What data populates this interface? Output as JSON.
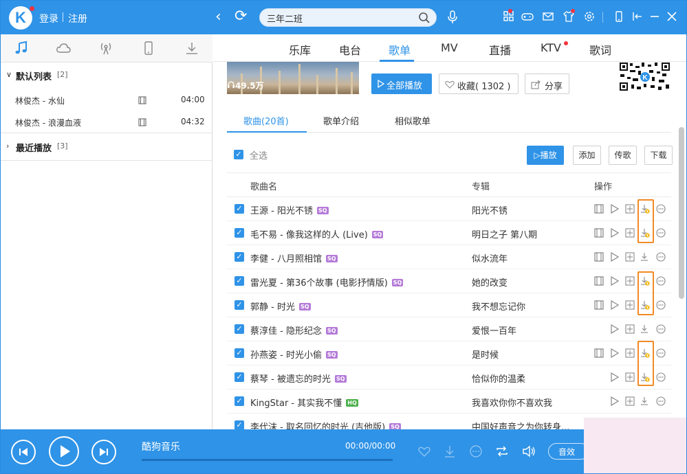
{
  "topbar": {
    "logo": "K",
    "login": "登录",
    "register": "注册",
    "search_value": "三年二班"
  },
  "left": {
    "groups": [
      {
        "name": "默认列表",
        "count": "[2]"
      },
      {
        "name": "最近播放",
        "count": "[3]"
      }
    ],
    "songs": [
      {
        "title": "林俊杰 - 水仙",
        "duration": "04:00"
      },
      {
        "title": "林俊杰 - 浪漫血液",
        "duration": "04:32"
      }
    ]
  },
  "main": {
    "tabs": [
      "乐库",
      "电台",
      "歌单",
      "MV",
      "直播",
      "KTV",
      "歌词"
    ],
    "active_tab": "歌单",
    "cover_count": "49.5万",
    "play_all": "全部播放",
    "favorite": "收藏( 1302 )",
    "share": "分享",
    "subtabs": [
      "歌曲(20首)",
      "歌单介绍",
      "相似歌单"
    ],
    "select_all": "全选",
    "actions": {
      "play": "播放",
      "add": "添加",
      "upload": "传歌",
      "download": "下载"
    },
    "columns": {
      "name": "歌曲名",
      "album": "专辑",
      "ops": "操作"
    },
    "songs": [
      {
        "name": "王源 - 阳光不锈",
        "quality": "SQ",
        "album": "阳光不锈"
      },
      {
        "name": "毛不易 - 像我这样的人 (Live)",
        "quality": "SQ",
        "album": "明日之子 第八期"
      },
      {
        "name": "李健 - 八月照相馆",
        "quality": "SQ",
        "album": "似水流年"
      },
      {
        "name": "雷光夏 - 第36个故事 (电影抒情版)",
        "quality": "SQ",
        "album": "她的改变"
      },
      {
        "name": "郭静 - 时光",
        "quality": "SQ",
        "album": "我不想忘记你"
      },
      {
        "name": "蔡淳佳 - 隐形纪念",
        "quality": "SQ",
        "album": "爱恨一百年"
      },
      {
        "name": "孙燕姿 - 时光小偷",
        "quality": "SQ",
        "album": "是时候"
      },
      {
        "name": "蔡琴 - 被遗忘的时光",
        "quality": "SQ",
        "album": "恰似你的温柔"
      },
      {
        "name": "KingStar - 其实我不懂",
        "quality": "HQ",
        "album": "我喜欢你你不喜欢我"
      },
      {
        "name": "李代沫 - 取名回忆的时光 (吉他版)",
        "quality": "SQ",
        "album": "中国好声音之为你转身..."
      }
    ]
  },
  "player": {
    "title": "酷狗音乐",
    "time": "00:00/00:00",
    "effect": "音效"
  },
  "colors": {
    "accent": "#2f93e7",
    "highlight": "#f28a24",
    "sq_badge": "#b47ad8",
    "hq_badge": "#4cb04c"
  }
}
